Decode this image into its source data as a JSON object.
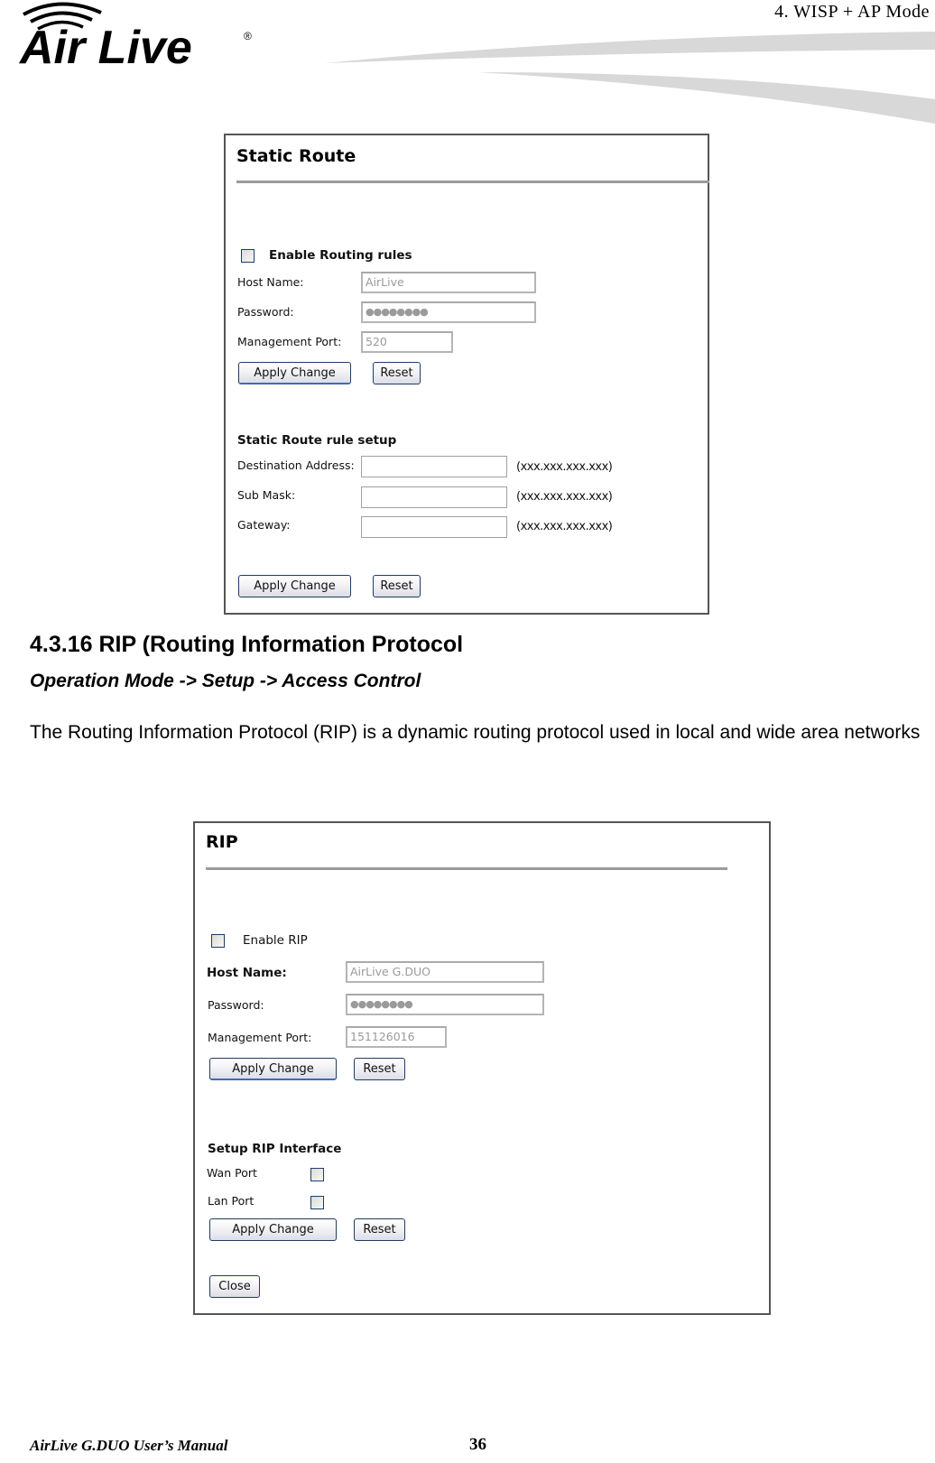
{
  "header": {
    "brand": "Air Live",
    "chapter": "4.  WISP  +  AP  Mode"
  },
  "static_route": {
    "title": "Static Route",
    "enable_label": "Enable Routing rules",
    "enable_checked": false,
    "host_name": {
      "label": "Host Name:",
      "value": "AirLive"
    },
    "password": {
      "label": "Password:",
      "value": "●●●●●●●●"
    },
    "management_port": {
      "label": "Management Port:",
      "value": "520"
    },
    "apply_label": "Apply Change",
    "reset_label": "Reset",
    "rule_setup": {
      "title": "Static Route rule setup",
      "fields": [
        {
          "label": "Destination Address:",
          "value": "",
          "hint": "(xxx.xxx.xxx.xxx)"
        },
        {
          "label": "Sub Mask:",
          "value": "",
          "hint": "(xxx.xxx.xxx.xxx)"
        },
        {
          "label": "Gateway:",
          "value": "",
          "hint": "(xxx.xxx.xxx.xxx)"
        }
      ],
      "apply_label": "Apply Change",
      "reset_label": "Reset"
    }
  },
  "section": {
    "heading": "4.3.16 RIP (Routing Information Protocol",
    "path": "Operation Mode -> Setup -> Access Control",
    "description": "The Routing Information Protocol (RIP) is a dynamic routing protocol used in local and wide area networks"
  },
  "rip": {
    "title": "RIP",
    "enable_label": "Enable RIP",
    "enable_checked": false,
    "host_name": {
      "label": "Host Name:",
      "value": "AirLive G.DUO"
    },
    "password": {
      "label": "Password:",
      "value": "●●●●●●●●"
    },
    "management_port": {
      "label": "Management Port:",
      "value": "151126016"
    },
    "apply_label": "Apply Change",
    "reset_label": "Reset",
    "interface": {
      "title": "Setup RIP Interface",
      "wan_label": "Wan Port",
      "wan_checked": false,
      "lan_label": "Lan Port",
      "lan_checked": false,
      "apply_label": "Apply Change",
      "reset_label": "Reset"
    },
    "close_label": "Close"
  },
  "footer": {
    "manual_title": "AirLive G.DUO User’s Manual",
    "page_number": "36"
  }
}
